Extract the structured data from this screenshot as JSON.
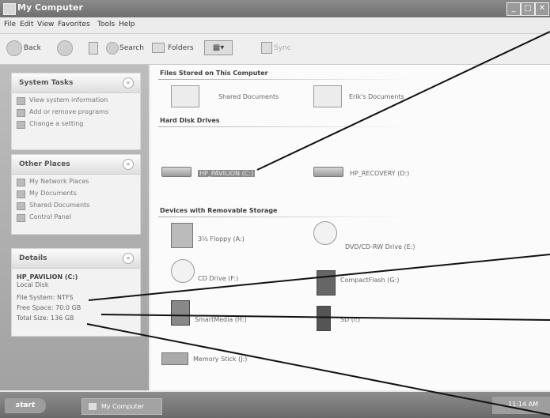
{
  "window": {
    "title": "My Computer"
  },
  "menu": [
    "File",
    "Edit",
    "View",
    "Favorites",
    "Tools",
    "Help"
  ],
  "toolbar": {
    "back": "Back",
    "search": "Search",
    "folders": "Folders",
    "views": "▦▾",
    "sync": "Sync"
  },
  "system_tasks": {
    "title": "System Tasks",
    "items": [
      "View system information",
      "Add or remove programs",
      "Change a setting"
    ]
  },
  "other_places": {
    "title": "Other Places",
    "items": [
      "My Network Places",
      "My Documents",
      "Shared Documents",
      "Control Panel"
    ]
  },
  "details": {
    "title": "Details",
    "name": "HP_PAVILION (C:)",
    "type": "Local Disk",
    "file_system": "File System: NTFS",
    "free_space": "Free Space: 70.0 GB",
    "total_size": "Total Size: 136 GB"
  },
  "sections": {
    "shared": {
      "title": "Files Stored on This Computer",
      "items": [
        "Shared Documents",
        "Erik's Documents"
      ]
    },
    "hard_disks": {
      "title": "Hard Disk Drives",
      "items": [
        "HP_PAVILION (C:)",
        "HP_RECOVERY (D:)"
      ]
    },
    "removable": {
      "title": "Devices with Removable Storage",
      "items": [
        "3½ Floppy (A:)",
        "DVD/CD-RW Drive (E:)",
        "CD Drive (F:)",
        "CompactFlash (G:)",
        "SmartMedia (H:)",
        "SD (I:)",
        "Memory Stick (J:)"
      ]
    }
  },
  "taskbar": {
    "start": "start",
    "task": "My Computer",
    "clock": "11:14 AM"
  }
}
